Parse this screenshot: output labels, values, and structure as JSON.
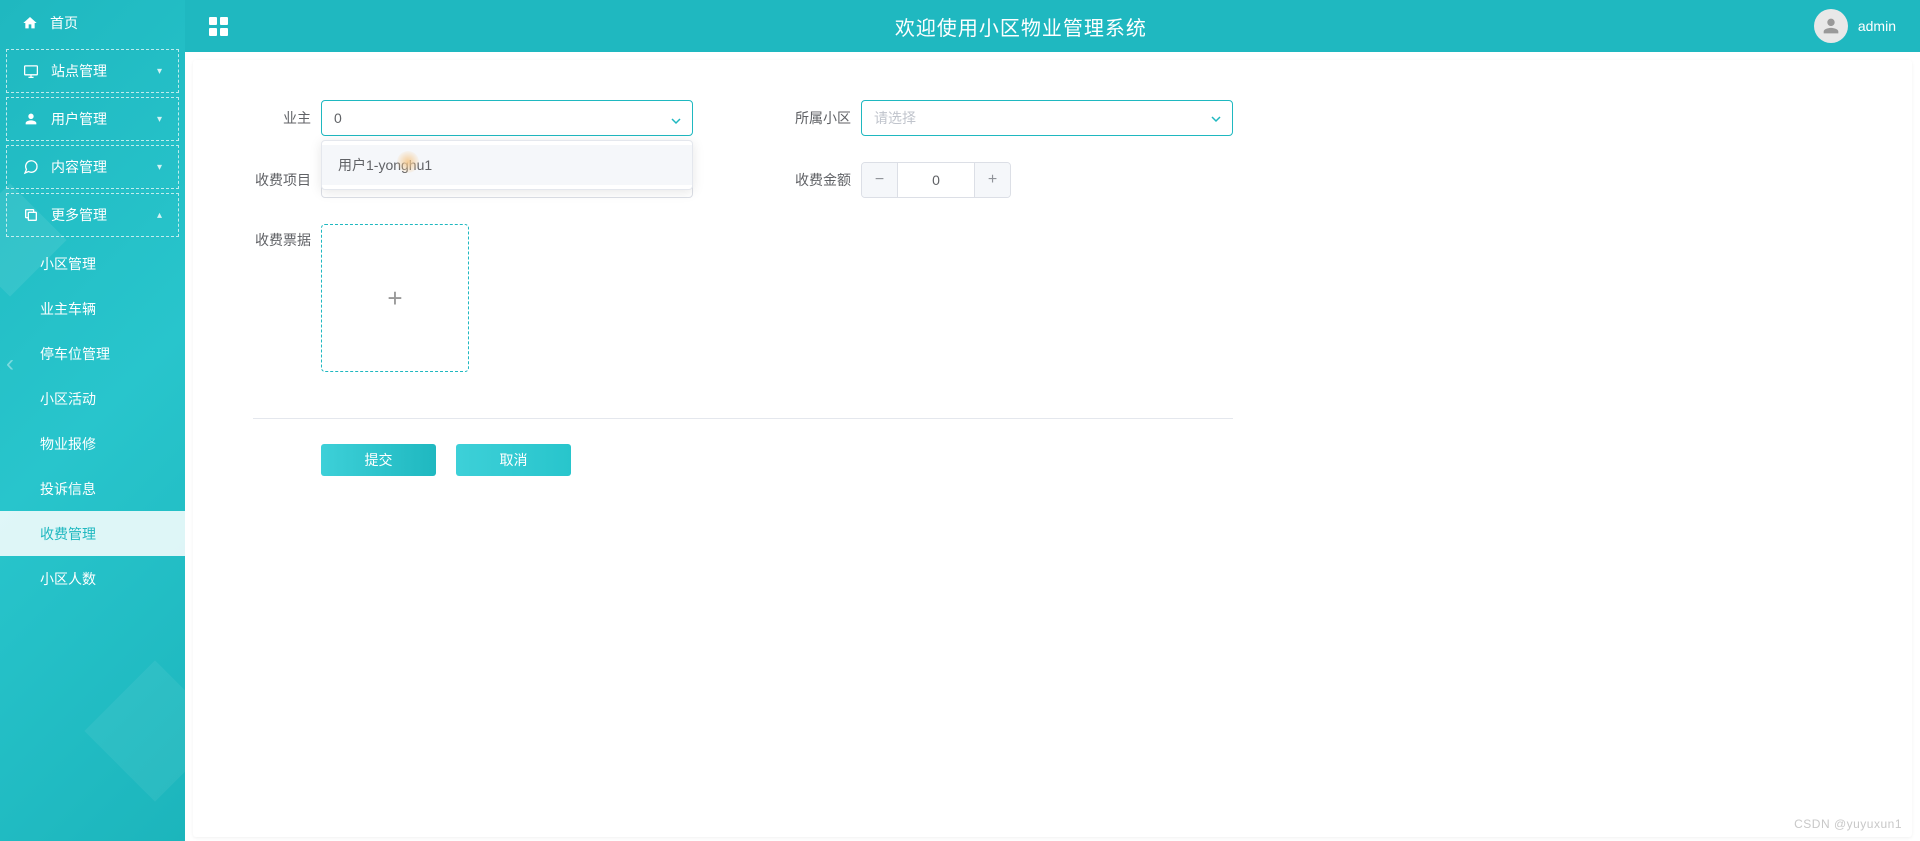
{
  "sidebar": {
    "home": "首页",
    "sections": [
      {
        "label": "站点管理",
        "expanded": false
      },
      {
        "label": "用户管理",
        "expanded": false
      },
      {
        "label": "内容管理",
        "expanded": false
      },
      {
        "label": "更多管理",
        "expanded": true
      }
    ],
    "submenu": [
      {
        "label": "小区管理",
        "active": false
      },
      {
        "label": "业主车辆",
        "active": false
      },
      {
        "label": "停车位管理",
        "active": false
      },
      {
        "label": "小区活动",
        "active": false
      },
      {
        "label": "物业报修",
        "active": false
      },
      {
        "label": "投诉信息",
        "active": false
      },
      {
        "label": "收费管理",
        "active": true
      },
      {
        "label": "小区人数",
        "active": false
      }
    ]
  },
  "header": {
    "title": "欢迎使用小区物业管理系统",
    "username": "admin"
  },
  "form": {
    "labels": {
      "owner": "业主",
      "community": "所属小区",
      "fee_item": "收费项目",
      "fee_amount": "收费金额",
      "receipt": "收费票据"
    },
    "owner_value": "0",
    "owner_dropdown_option": "用户1-yonghu1",
    "community_placeholder": "请选择",
    "fee_item_value": "",
    "fee_amount_value": "0"
  },
  "buttons": {
    "submit": "提交",
    "cancel": "取消"
  },
  "watermark": "CSDN @yuyuxun1"
}
